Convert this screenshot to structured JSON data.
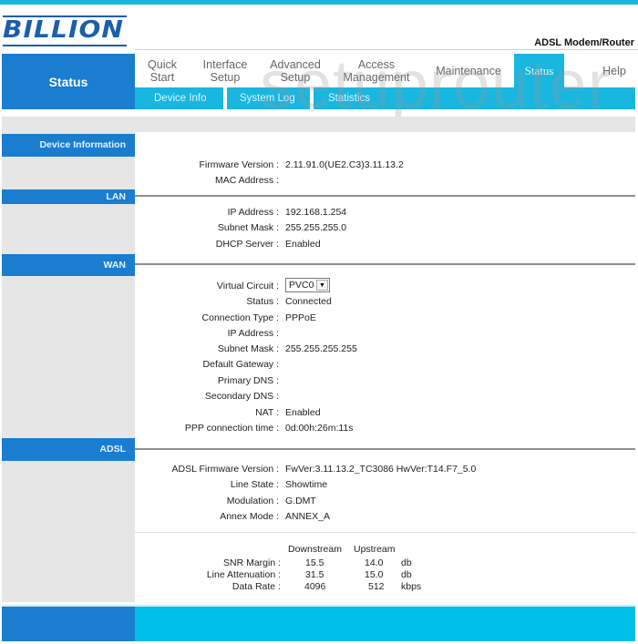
{
  "header": {
    "brand": "BILLION",
    "product": "ADSL Modem/Router",
    "section_title": "Status"
  },
  "nav": {
    "items": [
      {
        "label": "Quick\nStart"
      },
      {
        "label": "Interface\nSetup"
      },
      {
        "label": "Advanced\nSetup"
      },
      {
        "label": "Access\nManagement"
      },
      {
        "label": "Maintenance"
      },
      {
        "label": "Status",
        "active": true
      },
      {
        "label": "Help"
      }
    ],
    "subitems": [
      {
        "label": "Device Info"
      },
      {
        "label": "System Log"
      },
      {
        "label": "Statistics"
      }
    ]
  },
  "watermark": "setuprouter",
  "sections": {
    "device_info": {
      "title": "Device Information",
      "rows": [
        {
          "label": "Firmware Version :",
          "value": "2.11.91.0(UE2.C3)3.11.13.2"
        },
        {
          "label": "MAC Address :",
          "value": ""
        }
      ]
    },
    "lan": {
      "title": "LAN",
      "rows": [
        {
          "label": "IP Address :",
          "value": "192.168.1.254"
        },
        {
          "label": "Subnet Mask :",
          "value": "255.255.255.0"
        },
        {
          "label": "DHCP Server :",
          "value": "Enabled"
        }
      ]
    },
    "wan": {
      "title": "WAN",
      "virtual_circuit_label": "Virtual Circuit :",
      "virtual_circuit_value": "PVC0",
      "rows": [
        {
          "label": "Status :",
          "value": "Connected"
        },
        {
          "label": "Connection Type :",
          "value": "PPPoE"
        },
        {
          "label": "IP Address :",
          "value": ""
        },
        {
          "label": "Subnet Mask :",
          "value": "255.255.255.255"
        },
        {
          "label": "Default Gateway :",
          "value": ""
        },
        {
          "label": "Primary DNS :",
          "value": ""
        },
        {
          "label": "Secondary DNS :",
          "value": ""
        },
        {
          "label": "NAT :",
          "value": "Enabled"
        },
        {
          "label": "PPP connection time :",
          "value": "0d:00h:26m:11s"
        }
      ]
    },
    "adsl": {
      "title": "ADSL",
      "rows": [
        {
          "label": "ADSL Firmware Version :",
          "value": "FwVer:3.11.13.2_TC3086 HwVer:T14.F7_5.0"
        },
        {
          "label": "Line State :",
          "value": "Showtime"
        },
        {
          "label": "Modulation :",
          "value": "G.DMT"
        },
        {
          "label": "Annex Mode :",
          "value": "ANNEX_A"
        }
      ],
      "stats": {
        "headers": [
          "Downstream",
          "Upstream"
        ],
        "rows": [
          {
            "label": "SNR Margin :",
            "down": "15.5",
            "up": "14.0",
            "unit": "db"
          },
          {
            "label": "Line Attenuation :",
            "down": "31.5",
            "up": "15.0",
            "unit": "db"
          },
          {
            "label": "Data Rate :",
            "down": "4096",
            "up": "512",
            "unit": "kbps"
          }
        ]
      }
    }
  },
  "colors": {
    "primary_blue": "#1a7dcf",
    "accent_cyan": "#19b6e0",
    "sidebar_grey": "#e6e6e6"
  }
}
